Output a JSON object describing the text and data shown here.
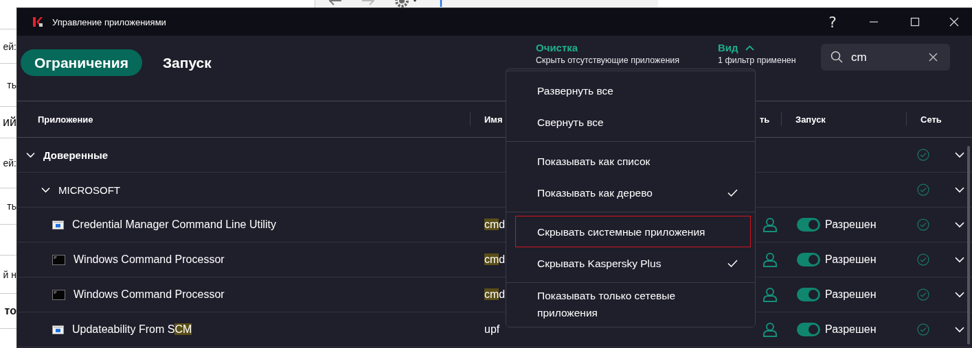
{
  "background": {
    "lines": [
      {
        "text": "ей:"
      },
      {
        "text": "ть"
      },
      {
        "text": "ий"
      },
      {
        "text": "ей:"
      },
      {
        "text": "ть"
      },
      {
        "text": "й н"
      },
      {
        "text": "то"
      }
    ]
  },
  "window": {
    "title": "Управление приложениями",
    "help": "?"
  },
  "tabs": [
    {
      "label": "Ограничения",
      "selected": true
    },
    {
      "label": "Запуск",
      "selected": false
    }
  ],
  "cleanup": {
    "label": "Очистка",
    "subtitle": "Скрыть отсутствующие приложения"
  },
  "view": {
    "label": "Вид",
    "expanded": true,
    "subtitle": "1 фильтр применен"
  },
  "search": {
    "value": "cm"
  },
  "table": {
    "columns": [
      "Приложение",
      "Имя",
      "ть",
      "Запуск",
      "Сеть"
    ],
    "rows": [
      {
        "kind": "group",
        "name": "Доверенные",
        "expanded": true,
        "children": [
          {
            "kind": "vendor",
            "name": "MICROSOFT",
            "expanded": true,
            "children": [
              {
                "kind": "window-app",
                "name_parts": [
                  {
                    "text": "Credential Manager Command Line Utility",
                    "match": false
                  }
                ],
                "file_parts": [
                  {
                    "text": "cm",
                    "match": true
                  },
                  {
                    "text": "d",
                    "match": false
                  }
                ],
                "launch": {
                  "on": true,
                  "text": "Разрешен"
                }
              },
              {
                "kind": "console-app",
                "name_parts": [
                  {
                    "text": "Windows Command Processor",
                    "match": false
                  }
                ],
                "file_parts": [
                  {
                    "text": "cm",
                    "match": true
                  },
                  {
                    "text": "d",
                    "match": false
                  }
                ],
                "launch": {
                  "on": true,
                  "text": "Разрешен"
                }
              },
              {
                "kind": "console-app",
                "name_parts": [
                  {
                    "text": "Windows Command Processor",
                    "match": false
                  }
                ],
                "file_parts": [
                  {
                    "text": "cm",
                    "match": true
                  },
                  {
                    "text": "d",
                    "match": false
                  }
                ],
                "launch": {
                  "on": true,
                  "text": "Разрешен"
                }
              },
              {
                "kind": "window-app",
                "name_parts": [
                  {
                    "text": "Updateability From S",
                    "match": false
                  },
                  {
                    "text": "CM",
                    "match": true
                  }
                ],
                "file_parts": [
                  {
                    "text": "upf",
                    "match": false
                  }
                ],
                "launch": {
                  "on": true,
                  "text": "Разрешен"
                }
              }
            ]
          }
        ]
      }
    ]
  },
  "menu": {
    "sections": [
      {
        "items": [
          {
            "label": "Развернуть все",
            "checked": false,
            "focused": false
          },
          {
            "label": "Свернуть все",
            "checked": false,
            "focused": false
          }
        ]
      },
      {
        "items": [
          {
            "label": "Показывать как список",
            "checked": false,
            "focused": false
          },
          {
            "label": "Показывать как дерево",
            "checked": true,
            "focused": false
          }
        ]
      },
      {
        "items": [
          {
            "label": "Скрывать системные приложения",
            "checked": false,
            "focused": true
          },
          {
            "label": "Скрывать Kaspersky Plus",
            "checked": true,
            "focused": false
          }
        ]
      },
      {
        "items": [
          {
            "label": "Показывать только сетевые приложения",
            "checked": false,
            "focused": false
          }
        ]
      }
    ]
  }
}
